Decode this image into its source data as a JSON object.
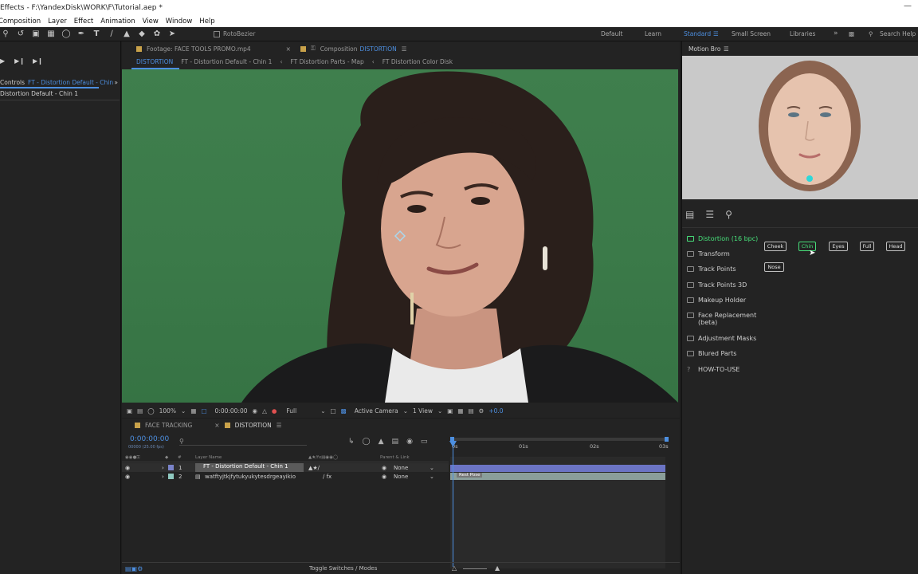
{
  "window": {
    "title": "Effects - F:\\YandexDisk\\WORK\\F\\Tutorial.aep *"
  },
  "menu": [
    "Composition",
    "Layer",
    "Effect",
    "Animation",
    "View",
    "Window",
    "Help"
  ],
  "toolbar": {
    "rotobezier_label": "RotoBezier"
  },
  "workspaces": {
    "default": "Default",
    "learn": "Learn",
    "standard": "Standard",
    "small_screen": "Small Screen",
    "libraries": "Libraries",
    "search_help": "Search Help"
  },
  "left": {
    "effect_controls_prefix": "Controls",
    "effect_controls_target": "FT - Distortion Default - Chin",
    "layer_label": "Distortion Default - Chin 1"
  },
  "comp": {
    "footage_tab": "Footage: FACE TOOLS PROMO.mp4",
    "comp_tab_prefix": "Composition",
    "comp_tab_name": "DISTORTION",
    "breadcrumbs": [
      "DISTORTION",
      "FT - Distortion Default - Chin 1",
      "FT Distortion Parts - Map",
      "FT Distortion Color Disk"
    ]
  },
  "viewerbar": {
    "zoom": "100%",
    "time": "0:00:00:00",
    "resolution": "Full",
    "camera": "Active Camera",
    "views": "1 View",
    "exposure": "+0.0"
  },
  "timeline": {
    "tabs": [
      "FACE TRACKING",
      "DISTORTION"
    ],
    "timecode": "0:00:00:00",
    "fps": "00000 (25.00 fps)",
    "col_layer_name": "Layer Name",
    "col_parent": "Parent & Link",
    "col_hash": "#",
    "ruler": [
      "0s",
      "01s",
      "02s",
      "03s"
    ],
    "layers": [
      {
        "num": "1",
        "name": "FT - Distortion Default - Chin 1",
        "parent": "None",
        "color": "#7a83c9"
      },
      {
        "num": "2",
        "name": "watftyjtkjfytukyukytesdrgeayikio",
        "parent": "None",
        "color": "#8fc9c0"
      }
    ],
    "keyframe_label": "Rest Pose",
    "toggle_label": "Toggle Switches / Modes"
  },
  "motionbro": {
    "title": "Motion Bro",
    "categories": [
      {
        "label": "Distortion (16 bpc)",
        "active": true
      },
      {
        "label": "Transform",
        "active": false
      },
      {
        "label": "Track Points",
        "active": false
      },
      {
        "label": "Track Points 3D",
        "active": false
      },
      {
        "label": "Makeup Holder",
        "active": false
      },
      {
        "label": "Face Replacement (beta)",
        "active": false
      },
      {
        "label": "Adjustment Masks",
        "active": false
      },
      {
        "label": "Blured Parts",
        "active": false
      },
      {
        "label": "HOW-TO-USE",
        "active": false
      }
    ],
    "presets": [
      {
        "label": "Cheek",
        "active": false
      },
      {
        "label": "Chin",
        "active": true
      },
      {
        "label": "Eyes",
        "active": false
      },
      {
        "label": "Full",
        "active": false
      },
      {
        "label": "Head",
        "active": false
      },
      {
        "label": "Nose",
        "active": false
      }
    ]
  },
  "colors": {
    "accent_blue": "#4d8fe0",
    "active_green": "#47e07a",
    "panel_bg": "#232323"
  },
  "icons": [
    "search-icon",
    "rotate-icon",
    "camera-icon",
    "pen-icon",
    "text-icon",
    "brush-icon",
    "stamp-icon",
    "eraser-icon",
    "pin-icon",
    "folder-icon",
    "sliders-icon",
    "eye-icon",
    "lock-icon",
    "play-icon"
  ]
}
